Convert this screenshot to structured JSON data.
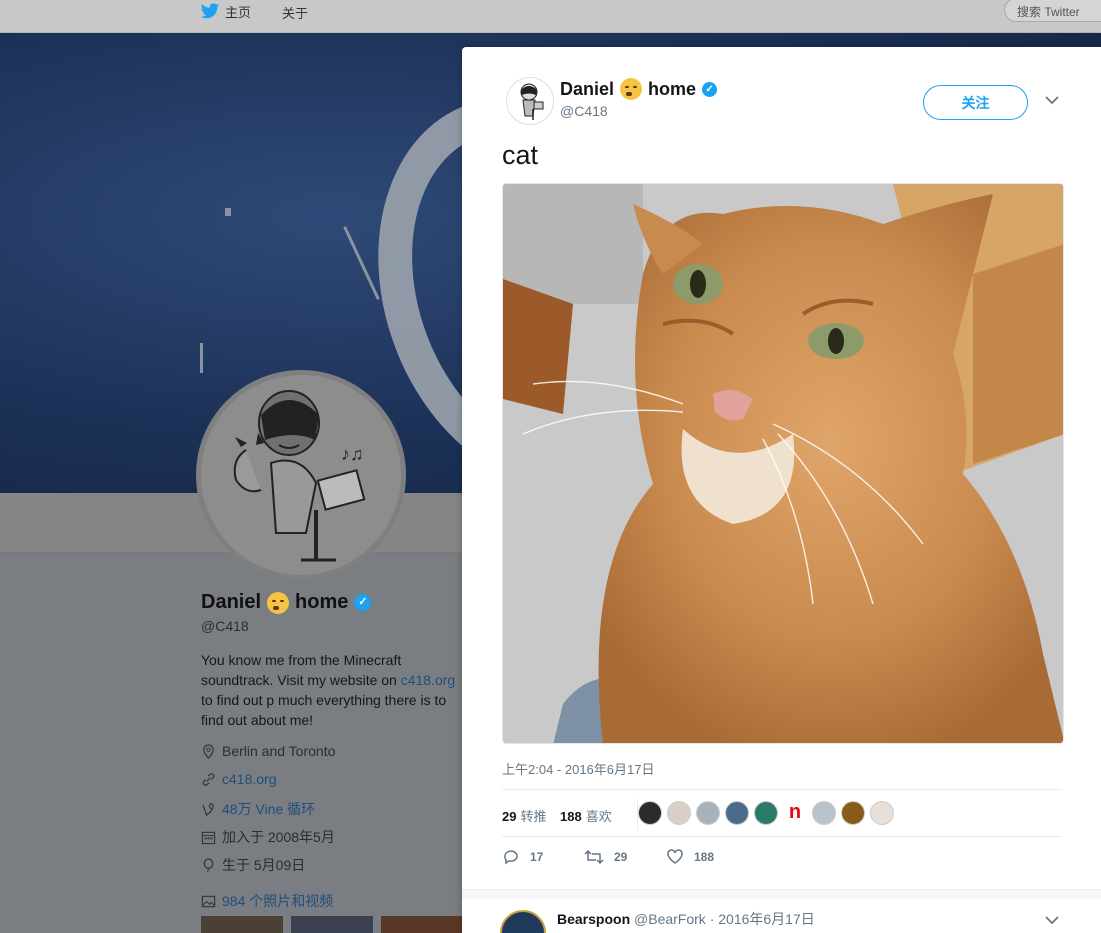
{
  "topnav": {
    "home_label": "主页",
    "about_label": "关于",
    "search_placeholder": "搜索 Twitter"
  },
  "profile": {
    "name": "Daniel",
    "name_suffix": "home",
    "handle": "@C418",
    "bio_part1": "You know me from the Minecraft soundtrack. Visit my website on ",
    "bio_link": "c418.org",
    "bio_part2": " to find out p much everything there is to find out about me!",
    "location": "Berlin and Toronto",
    "website": "c418.org",
    "vine": "48万 Vine 循环",
    "joined": "加入于 2008年5月",
    "birthday": "生于 5月09日",
    "media_count": "984 个照片和视频"
  },
  "modal": {
    "author_name": "Daniel",
    "author_name_suffix": "home",
    "author_handle": "@C418",
    "follow_label": "关注",
    "tweet_text": "cat",
    "timestamp": "上午2:04 - 2016年6月17日",
    "retweets_count": "29",
    "retweets_label": "转推",
    "likes_count": "188",
    "likes_label": "喜欢",
    "likers_n_label": "n",
    "replies_action_count": "17",
    "retweet_action_count": "29",
    "like_action_count": "188"
  },
  "reply": {
    "name": "Bearspoon",
    "handle": "@BearFork",
    "date": "· 2016年6月17日"
  },
  "colors": {
    "accent": "#1da1f2",
    "text_secondary": "#657786",
    "netflix_red": "#e50914"
  }
}
